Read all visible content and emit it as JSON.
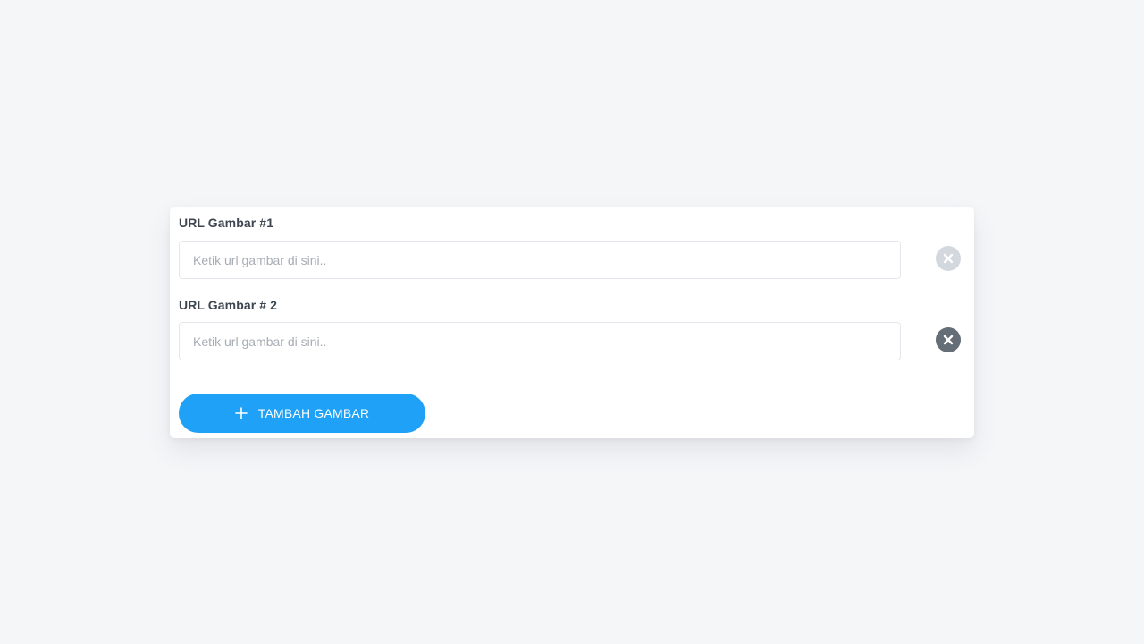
{
  "form": {
    "fields": [
      {
        "label": "URL Gambar #1",
        "value": "",
        "placeholder": "Ketik url gambar di sini..",
        "remove_icon": "close-circle-icon",
        "remove_state": "disabled",
        "remove_color": "#d3d8de"
      },
      {
        "label": "URL Gambar # 2",
        "value": "",
        "placeholder": "Ketik url gambar di sini..",
        "remove_icon": "close-circle-icon",
        "remove_state": "enabled",
        "remove_color": "#656d76"
      }
    ],
    "add_button": {
      "label": "TAMBAH GAMBAR",
      "icon": "plus-icon",
      "color": "#1ea1f7"
    }
  },
  "colors": {
    "background": "#f5f6f8",
    "card": "#ffffff",
    "label_text": "#3d4650",
    "placeholder_text": "#a7adb4"
  }
}
